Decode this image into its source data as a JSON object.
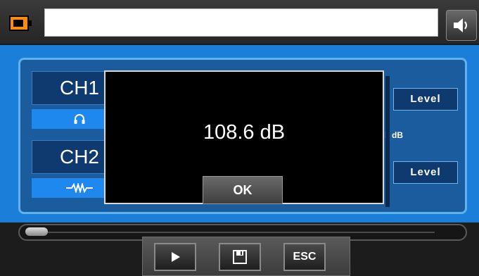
{
  "header": {
    "title_value": "",
    "battery_icon": "battery-icon",
    "speaker_icon": "speaker-icon"
  },
  "channels": [
    {
      "label": "CH1",
      "icon": "headphones-icon"
    },
    {
      "label": "CH2",
      "icon": "waveform-icon"
    }
  ],
  "level_buttons": [
    "Level",
    "Level"
  ],
  "db_unit": "dB",
  "dialog": {
    "value": "108.6 dB",
    "ok_label": "OK"
  },
  "progress": {
    "value": 0
  },
  "controls": {
    "play_icon": "play-icon",
    "save_icon": "save-icon",
    "esc_label": "ESC"
  },
  "colors": {
    "main_bg": "#1b7ed8",
    "panel_bg": "#1a5c9e",
    "accent": "#ff8c00"
  }
}
